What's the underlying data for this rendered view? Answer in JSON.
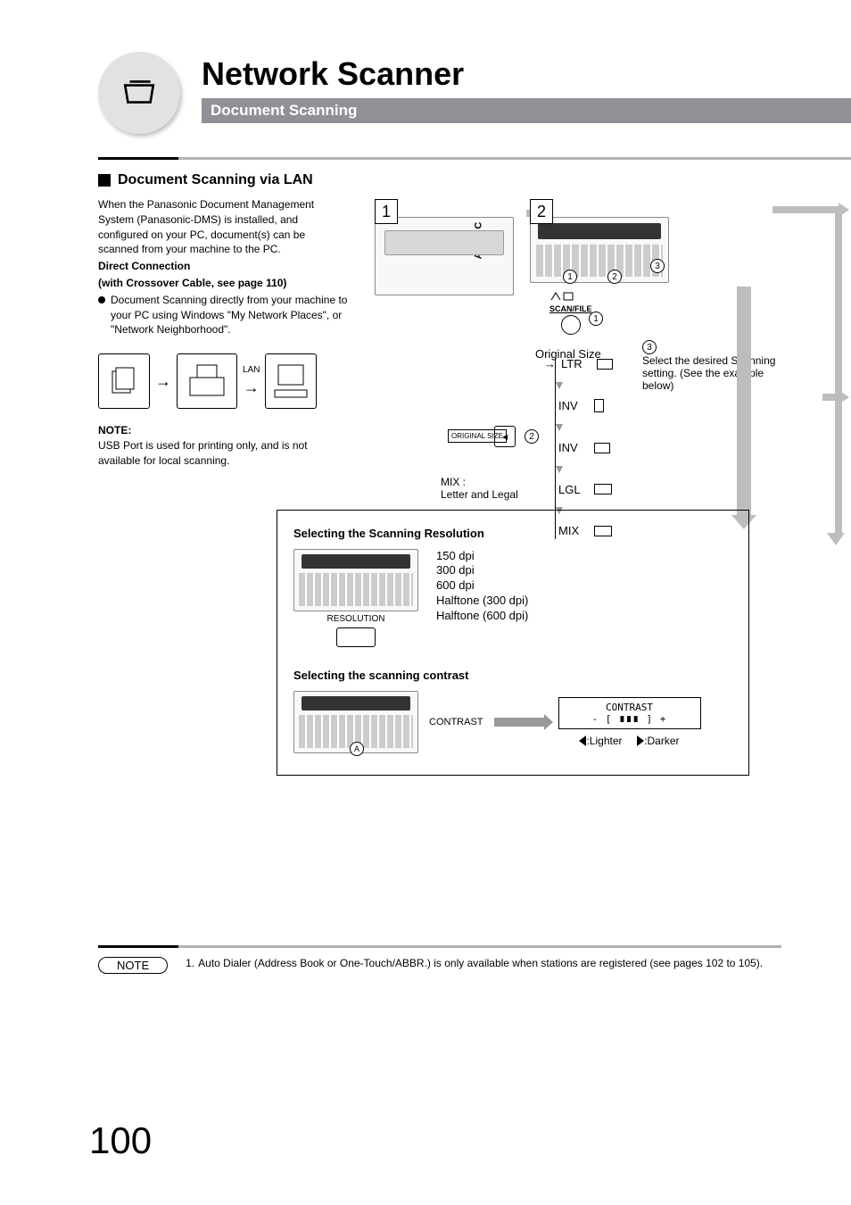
{
  "header": {
    "title": "Network Scanner",
    "subtitle": "Document Scanning"
  },
  "section": {
    "heading": "Document Scanning via LAN"
  },
  "intro": {
    "p1": "When the Panasonic Document Management System (Panasonic-DMS) is installed, and configured on your PC, document(s) can be scanned from your machine to the PC.",
    "direct_heading": "Direct Connection",
    "direct_sub": "(with Crossover Cable, see page 110)",
    "bullet": "Document Scanning directly from your machine to your PC using Windows \"My Network Places\", or \"Network Neighborhood\".",
    "lan_label": "LAN",
    "note_heading": "NOTE:",
    "note_text": "USB Port is used for printing only, and is not available for local scanning."
  },
  "steps": {
    "s1": "1",
    "s2": "2",
    "scanfile": "SCAN/FILE",
    "c1": "1",
    "c2": "2",
    "c3": "3",
    "original_size_label": "Original Size",
    "os_btn": "ORIGINAL SIZE",
    "sizes": {
      "ltr": "LTR",
      "inv1": "INV",
      "inv2": "INV",
      "lgl": "LGL",
      "mix": "MIX"
    },
    "mix_label1": "MIX :",
    "mix_label2": "Letter and Legal",
    "sel3_text": "Select the desired Scanning setting. (See the example below)"
  },
  "resbox": {
    "h1": "Selecting the Scanning Resolution",
    "res_caption": "RESOLUTION",
    "options": {
      "o1": "150 dpi",
      "o2": "300 dpi",
      "o3": "600 dpi",
      "o4": "Halftone (300 dpi)",
      "o5": "Halftone (600 dpi)"
    },
    "h2": "Selecting the scanning contrast",
    "contrast_label": "CONTRAST",
    "lcd_label": "CONTRAST",
    "lcd_bar": "- [ ∎∎∎      ] +",
    "lighter": ":Lighter",
    "darker": ":Darker",
    "circ_a": "A"
  },
  "footer": {
    "note_chip": "NOTE",
    "note_num": "1.",
    "note_text": "Auto Dialer (Address Book or One-Touch/ABBR.) is only available when stations are registered (see pages 102 to 105).",
    "page_number": "100"
  }
}
